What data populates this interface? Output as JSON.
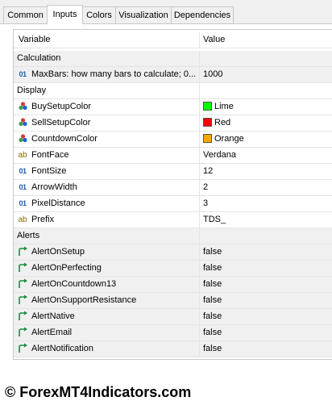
{
  "tabs": [
    {
      "label": "Common"
    },
    {
      "label": "Inputs"
    },
    {
      "label": "Colors"
    },
    {
      "label": "Visualization"
    },
    {
      "label": "Dependencies"
    }
  ],
  "active_tab": "Inputs",
  "table": {
    "header": {
      "variable": "Variable",
      "value": "Value"
    },
    "groups": {
      "calculation": "Calculation",
      "display": "Display",
      "alerts": "Alerts"
    },
    "rows": {
      "maxbars": {
        "name": "MaxBars: how many bars to calculate; 0...",
        "value": "1000",
        "icon": "number-icon"
      },
      "buysetupcolor": {
        "name": "BuySetupColor",
        "value": "Lime",
        "color": "#00ff00",
        "icon": "color-palette-icon"
      },
      "sellsetupcolor": {
        "name": "SellSetupColor",
        "value": "Red",
        "color": "#ff0000",
        "icon": "color-palette-icon"
      },
      "countdowncolor": {
        "name": "CountdownColor",
        "value": "Orange",
        "color": "#ffa500",
        "icon": "color-palette-icon"
      },
      "fontface": {
        "name": "FontFace",
        "value": "Verdana",
        "icon": "string-icon"
      },
      "fontsize": {
        "name": "FontSize",
        "value": "12",
        "icon": "number-icon"
      },
      "arrowwidth": {
        "name": "ArrowWidth",
        "value": "2",
        "icon": "number-icon"
      },
      "pixeldistance": {
        "name": "PixelDistance",
        "value": "3",
        "icon": "number-icon"
      },
      "prefix": {
        "name": "Prefix",
        "value": "TDS_",
        "icon": "string-icon"
      },
      "alertonsetup": {
        "name": "AlertOnSetup",
        "value": "false",
        "icon": "bool-arrow-icon"
      },
      "alertonperfecting": {
        "name": "AlertOnPerfecting",
        "value": "false",
        "icon": "bool-arrow-icon"
      },
      "alertoncountdown13": {
        "name": "AlertOnCountdown13",
        "value": "false",
        "icon": "bool-arrow-icon"
      },
      "alertonsupportresistance": {
        "name": "AlertOnSupportResistance",
        "value": "false",
        "icon": "bool-arrow-icon"
      },
      "alertnative": {
        "name": "AlertNative",
        "value": "false",
        "icon": "bool-arrow-icon"
      },
      "alertemail": {
        "name": "AlertEmail",
        "value": "false",
        "icon": "bool-arrow-icon"
      },
      "alertnotification": {
        "name": "AlertNotification",
        "value": "false",
        "icon": "bool-arrow-icon"
      }
    },
    "type_glyphs": {
      "number": "01",
      "string": "ab"
    }
  },
  "watermark": "© ForexMT4Indicators.com"
}
